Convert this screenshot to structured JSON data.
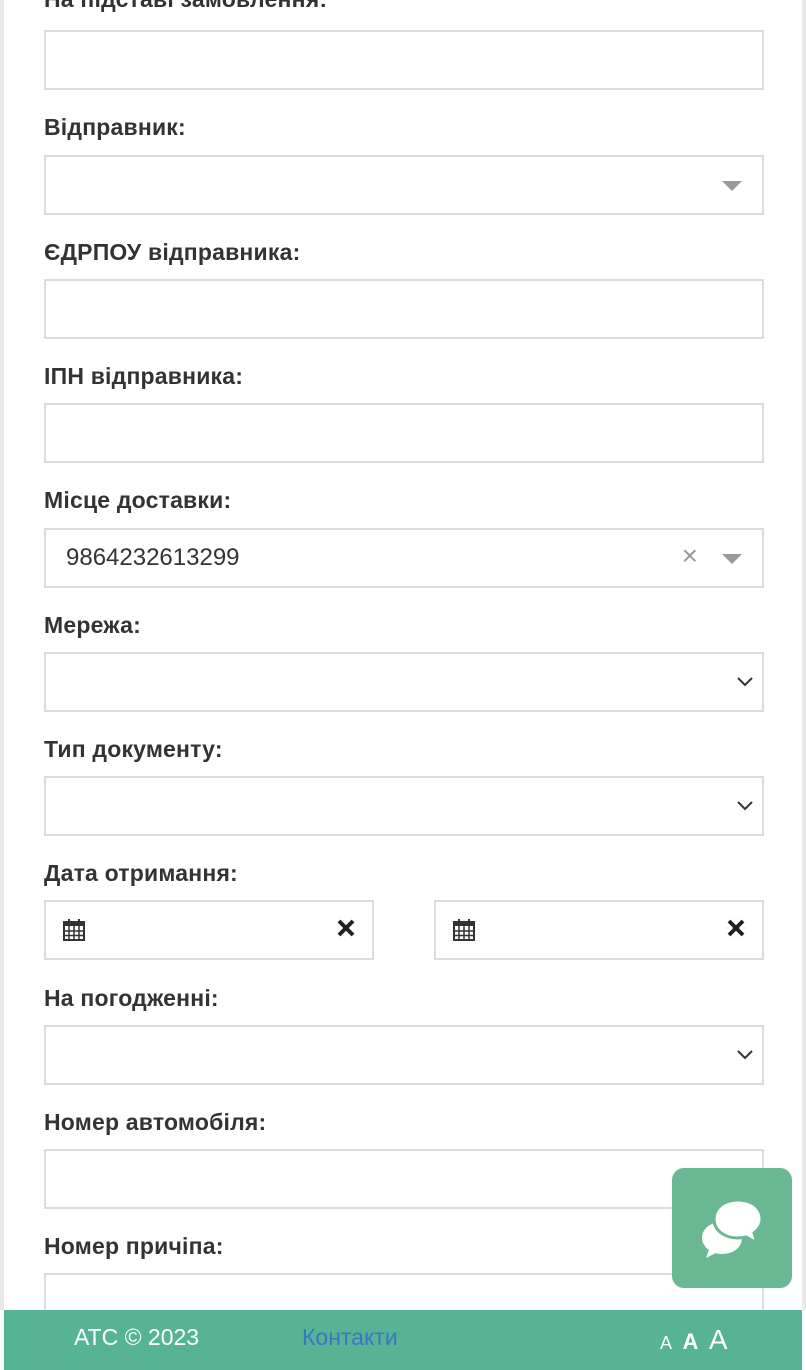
{
  "form": {
    "order_basis": {
      "label": "На підставі замовлення:",
      "value": ""
    },
    "sender": {
      "label": "Відправник:",
      "value": ""
    },
    "sender_edrpou": {
      "label": "ЄДРПОУ відправника:",
      "value": ""
    },
    "sender_ipn": {
      "label": "ІПН відправника:",
      "value": ""
    },
    "delivery_place": {
      "label": "Місце доставки:",
      "value": "9864232613299"
    },
    "network": {
      "label": "Мережа:",
      "value": ""
    },
    "document_type": {
      "label": "Тип документу:",
      "value": ""
    },
    "receipt_date": {
      "label": "Дата отримання:",
      "from": "",
      "to": ""
    },
    "on_approval": {
      "label": "На погодженні:",
      "value": ""
    },
    "car_number": {
      "label": "Номер автомобіля:",
      "value": ""
    },
    "trailer_number": {
      "label": "Номер причіпа:",
      "value": ""
    }
  },
  "footer": {
    "copyright": "АТС © 2023",
    "contacts_link": "Контакти",
    "font_size_small": "A",
    "font_size_medium": "A",
    "font_size_large": "A"
  },
  "colors": {
    "footer_bg": "#56b494",
    "chat_button_bg": "#6ab793",
    "link": "#3c74c4"
  },
  "icons": {
    "calendar": "calendar-icon",
    "clear": "close-icon",
    "dropdown": "caret-down-icon",
    "chat": "chat-bubbles-icon"
  }
}
